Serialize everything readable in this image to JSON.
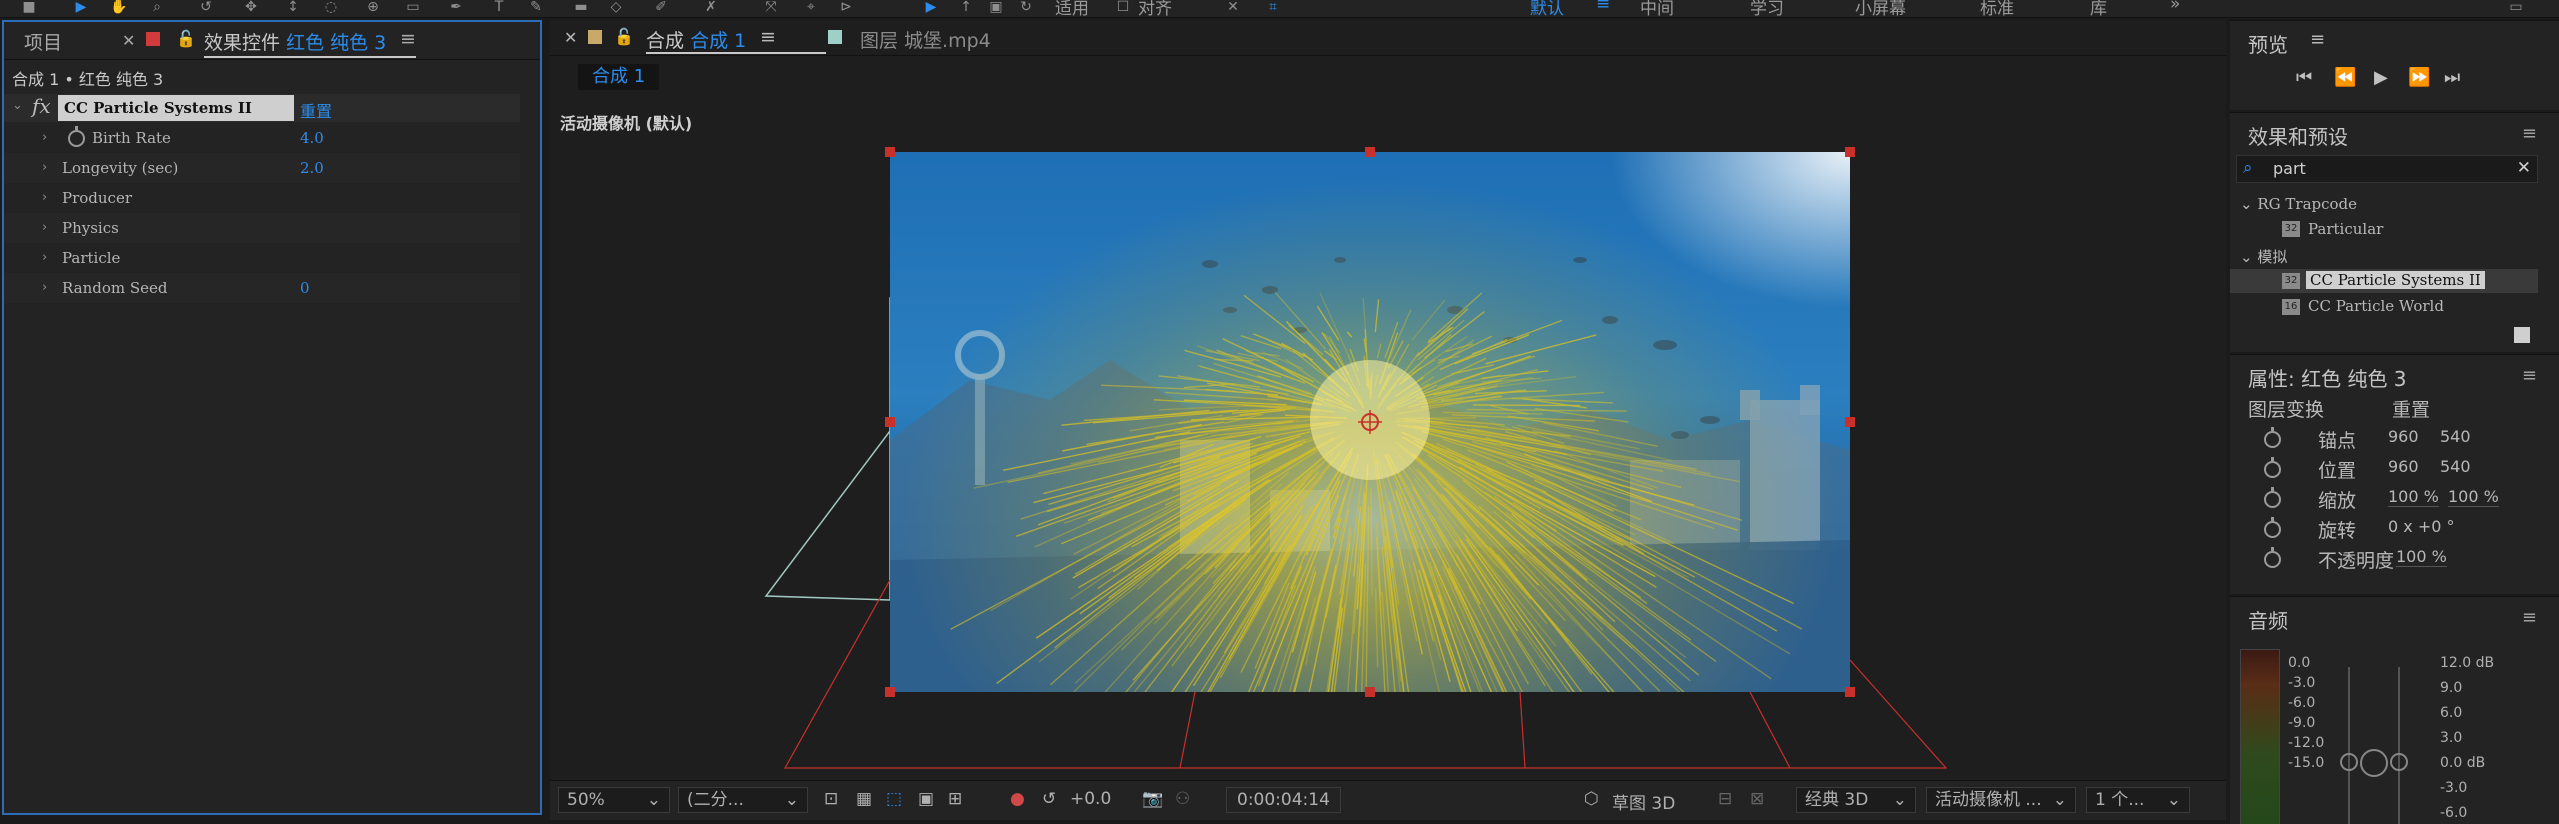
{
  "toolbar": {
    "workspaces": [
      "默认",
      "中间",
      "学习",
      "小屏幕",
      "标准",
      "库"
    ],
    "tools": [
      "play-icon",
      "selection-arrow-icon",
      "hand-icon",
      "zoom-icon",
      "rotate-icon",
      "camera-orbit-icon",
      "pan-icon",
      "mask-icon",
      "pen-icon",
      "text-icon",
      "brush-icon",
      "stamp-icon",
      "eraser-icon",
      "roto-icon",
      "puppet-icon"
    ],
    "snap_label": "适用",
    "align_label": "对齐"
  },
  "left_panel": {
    "tabs": {
      "project": "项目",
      "effects_controls_prefix": "效果控件",
      "effects_controls_layer": "红色 纯色 3"
    },
    "breadcrumb": "合成 1 • 红色 纯色 3",
    "effect_name": "CC Particle Systems II",
    "reset_label": "重置",
    "properties": [
      {
        "label": "Birth Rate",
        "value": "4.0"
      },
      {
        "label": "Longevity (sec)",
        "value": "2.0"
      },
      {
        "label": "Producer",
        "value": ""
      },
      {
        "label": "Physics",
        "value": ""
      },
      {
        "label": "Particle",
        "value": ""
      },
      {
        "label": "Random Seed",
        "value": "0"
      }
    ]
  },
  "center_panel": {
    "tabs": {
      "comp_prefix": "合成",
      "comp_name": "合成 1",
      "layer_label": "图层 城堡.mp4"
    },
    "sub_tab": "合成 1",
    "camera_label": "活动摄像机 (默认)",
    "bottom": {
      "zoom": "50%",
      "resolution": "(二分...",
      "exposure": "+0.0",
      "timecode": "0:00:04:14",
      "draft3d": "草图 3D",
      "renderer": "经典 3D",
      "camera": "活动摄像机 ...",
      "views": "1 个..."
    }
  },
  "preview_panel": {
    "title": "预览"
  },
  "effects_presets_panel": {
    "title": "效果和预设",
    "search_value": "part",
    "groups": [
      {
        "name": "RG Trapcode",
        "items": [
          "Particular"
        ]
      },
      {
        "name": "模拟",
        "items": [
          "CC Particle Systems II",
          "CC Particle World"
        ]
      }
    ],
    "selected_item": "CC Particle Systems II",
    "badge_text": [
      "32",
      "32",
      "16"
    ]
  },
  "properties_panel": {
    "title": "属性: 红色 纯色 3",
    "section": "图层变换",
    "reset_label": "重置",
    "rows": [
      {
        "label": "锚点",
        "v1": "960",
        "v2": "540"
      },
      {
        "label": "位置",
        "v1": "960",
        "v2": "540"
      },
      {
        "label": "缩放",
        "v1": "100 %",
        "v2": "100 %"
      },
      {
        "label": "旋转",
        "v1": "0 x +0 °",
        "v2": ""
      },
      {
        "label": "不透明度",
        "v1": "100 %",
        "v2": ""
      }
    ]
  },
  "audio_panel": {
    "title": "音频",
    "left_scale": [
      "0.0",
      "-3.0",
      "-6.0",
      "-9.0",
      "-12.0",
      "-15.0"
    ],
    "right_scale": [
      "12.0 dB",
      "9.0",
      "6.0",
      "3.0",
      "0.0 dB",
      "-3.0",
      "-6.0"
    ]
  },
  "colors": {
    "accent": "#2d8ceb",
    "panel_bg": "#232323",
    "frame_red": "#c8302c",
    "particle_yellow": "#f2d21e"
  }
}
